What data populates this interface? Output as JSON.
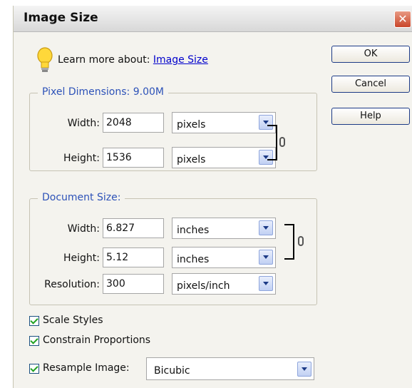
{
  "window": {
    "title": "Image Size",
    "close_glyph": "✕"
  },
  "learn_more": {
    "text": "Learn more about: ",
    "link_text": "Image Size"
  },
  "buttons": {
    "ok": "OK",
    "cancel": "Cancel",
    "help": "Help"
  },
  "pixel_dimensions": {
    "legend": "Pixel Dimensions: 9.00M",
    "width_label": "Width:",
    "width_value": "2048",
    "width_unit": "pixels",
    "height_label": "Height:",
    "height_value": "1536",
    "height_unit": "pixels"
  },
  "document_size": {
    "legend": "Document Size:",
    "width_label": "Width:",
    "width_value": "6.827",
    "width_unit": "inches",
    "height_label": "Height:",
    "height_value": "5.12",
    "height_unit": "inches",
    "resolution_label": "Resolution:",
    "resolution_value": "300",
    "resolution_unit": "pixels/inch"
  },
  "options": {
    "scale_styles": {
      "label": "Scale Styles",
      "checked": true
    },
    "constrain_proportions": {
      "label": "Constrain Proportions",
      "checked": true
    },
    "resample_image": {
      "label": "Resample Image:",
      "checked": true,
      "method": "Bicubic"
    }
  },
  "colors": {
    "accent": "#2d52b8",
    "link": "#0000cc",
    "close": "#c9452a",
    "check": "#21a121"
  }
}
